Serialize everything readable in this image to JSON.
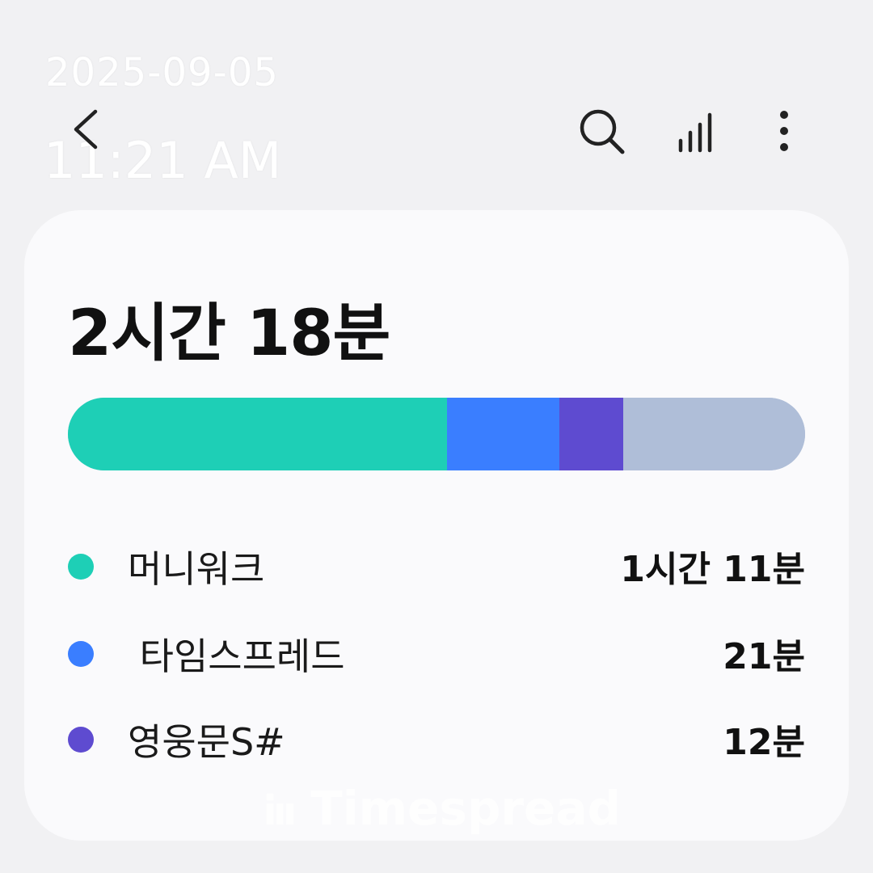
{
  "timestamp": {
    "date": "2025-09-05",
    "time": "11:21 AM"
  },
  "toolbar": {
    "back_icon": "chevron-left-icon",
    "search_icon": "search-icon",
    "signal_icon": "bar-chart-icon",
    "more_icon": "more-vertical-icon"
  },
  "summary": {
    "total_label": "2시간 18분"
  },
  "usage_bar": {
    "segments": [
      {
        "app": "머니워크",
        "minutes": 71,
        "color": "#1ecfb6"
      },
      {
        "app": "타임스프레드",
        "minutes": 21,
        "color": "#3a7eff"
      },
      {
        "app": "영웅문S#",
        "minutes": 12,
        "color": "#5e4bd0"
      }
    ],
    "other_minutes": 34,
    "other_color": "#afbed8"
  },
  "apps": [
    {
      "name": "머니워크",
      "time": "1시간 11분",
      "color": "#1ecfb6"
    },
    {
      "name": " 타임스프레드",
      "time": "21분",
      "color": "#3a7eff"
    },
    {
      "name": "영웅문S#",
      "time": "12분",
      "color": "#5e4bd0"
    }
  ],
  "watermark": {
    "text": "Timespread"
  }
}
